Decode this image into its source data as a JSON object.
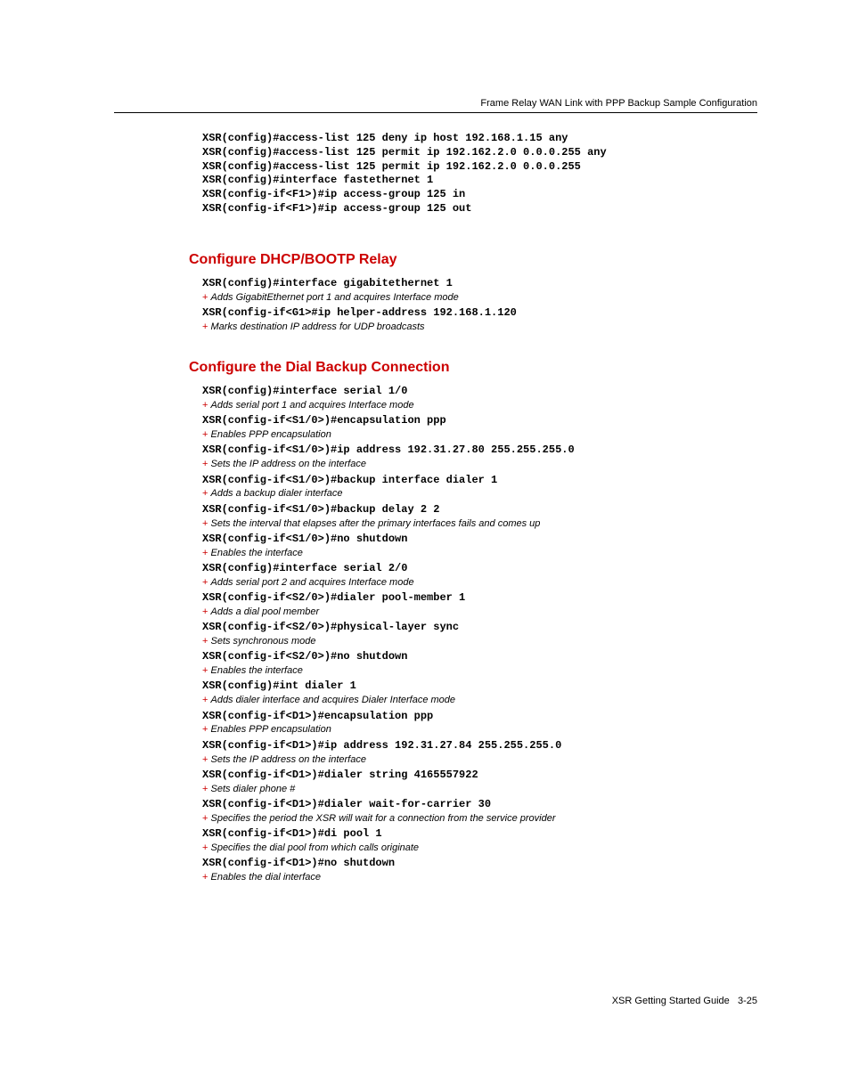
{
  "running_header": "Frame Relay WAN Link with PPP Backup Sample Configuration",
  "intro_code": [
    "XSR(config)#access-list 125 deny ip host 192.168.1.15 any",
    "XSR(config)#access-list 125 permit ip 192.162.2.0 0.0.0.255 any",
    "XSR(config)#access-list 125 permit ip 192.162.2.0 0.0.0.255",
    "XSR(config)#interface fastethernet 1",
    "XSR(config-if<F1>)#ip access-group 125 in",
    "XSR(config-if<F1>)#ip access-group 125 out"
  ],
  "section1": {
    "heading": "Configure DHCP/BOOTP Relay",
    "items": [
      {
        "code": "XSR(config)#interface gigabitethernet 1",
        "comment": "Adds GigabitEthernet port 1 and acquires Interface mode"
      },
      {
        "code": "XSR(config-if<G1>#ip helper-address 192.168.1.120",
        "comment": "Marks destination IP address for UDP broadcasts"
      }
    ]
  },
  "section2": {
    "heading": "Configure the Dial Backup Connection",
    "items": [
      {
        "code": "XSR(config)#interface serial 1/0",
        "comment": "Adds serial port 1 and acquires Interface mode"
      },
      {
        "code": "XSR(config-if<S1/0>)#encapsulation ppp",
        "comment": "Enables PPP encapsulation"
      },
      {
        "code": "XSR(config-if<S1/0>)#ip address 192.31.27.80 255.255.255.0",
        "comment": "Sets the IP address on the interface"
      },
      {
        "code": "XSR(config-if<S1/0>)#backup interface dialer 1",
        "comment": "Adds a backup dialer interface"
      },
      {
        "code": "XSR(config-if<S1/0>)#backup delay 2 2",
        "comment": "Sets the interval that elapses after the primary interfaces fails and comes up"
      },
      {
        "code": "XSR(config-if<S1/0>)#no shutdown",
        "comment": "Enables the interface"
      },
      {
        "code": "XSR(config)#interface serial 2/0",
        "comment": "Adds serial port 2 and acquires Interface mode"
      },
      {
        "code": "XSR(config-if<S2/0>)#dialer pool-member 1",
        "comment": "Adds a dial pool member"
      },
      {
        "code": "XSR(config-if<S2/0>)#physical-layer sync",
        "comment": "Sets synchronous mode"
      },
      {
        "code": "XSR(config-if<S2/0>)#no shutdown",
        "comment": "Enables the interface"
      },
      {
        "code": "XSR(config)#int dialer 1",
        "comment": "Adds dialer interface and acquires Dialer Interface mode"
      },
      {
        "code": "XSR(config-if<D1>)#encapsulation ppp",
        "comment": "Enables PPP encapsulation"
      },
      {
        "code": "XSR(config-if<D1>)#ip address 192.31.27.84 255.255.255.0",
        "comment": "Sets the IP address on the interface"
      },
      {
        "code": "XSR(config-if<D1>)#dialer string 4165557922",
        "comment": "Sets dialer phone #"
      },
      {
        "code": "XSR(config-if<D1>)#dialer wait-for-carrier 30",
        "comment": "Specifies the period the XSR will wait for a connection from the service provider"
      },
      {
        "code": "XSR(config-if<D1>)#di pool 1",
        "comment": "Specifies the dial pool from which calls originate"
      },
      {
        "code": "XSR(config-if<D1>)#no shutdown",
        "comment": "Enables the dial interface"
      }
    ]
  },
  "footer": {
    "book": "XSR Getting Started Guide",
    "page": "3-25"
  }
}
